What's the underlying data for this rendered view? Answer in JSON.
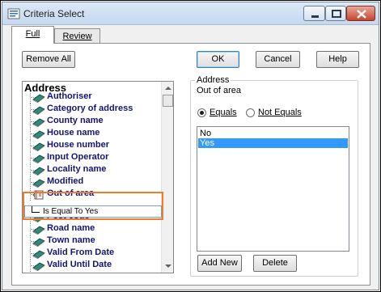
{
  "window": {
    "title": "Criteria Select"
  },
  "tabs": [
    {
      "label": "Full",
      "active": true
    },
    {
      "label": "Review",
      "active": false
    }
  ],
  "buttons": {
    "remove_all": "Remove All",
    "ok": "OK",
    "cancel": "Cancel",
    "help": "Help",
    "add_new": "Add New",
    "delete": "Delete"
  },
  "tree": {
    "root": "Address",
    "items": [
      "Authoriser",
      "Category of address",
      "County name",
      "House name",
      "House number",
      "Input Operator",
      "Locality name",
      "Modified",
      "Out of area",
      "Post code",
      "Road name",
      "Town name",
      "Valid From Date",
      "Valid Until Date"
    ],
    "selected_child": "Is Equal To Yes"
  },
  "criteria": {
    "group_title": "Address",
    "field": "Out of area",
    "radio_equals": "Equals",
    "radio_not_equals": "Not Equals",
    "selected_radio": "Equals",
    "values": [
      "No",
      "Yes"
    ],
    "selected_value": "Yes"
  },
  "colors": {
    "highlight": "#f07b2a",
    "tree_text": "#141478",
    "selection": "#3399ff"
  }
}
